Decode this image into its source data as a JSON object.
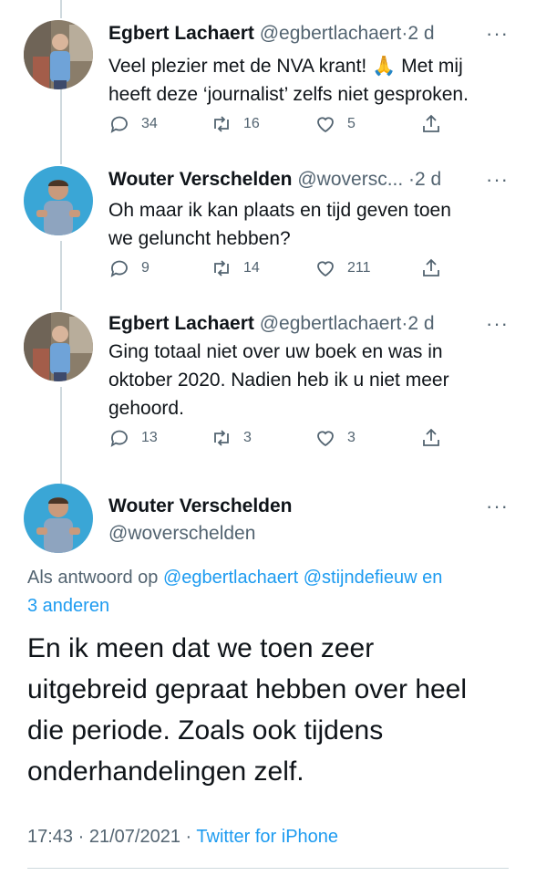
{
  "tweets": [
    {
      "name": "Egbert Lachaert",
      "handle": "@egbertlachaert",
      "sep": "·",
      "time": "2 d",
      "more": "···",
      "lines": [
        "Veel plezier met de NVA krant! 🙏 Met mij",
        "heeft deze ‘journalist’ zelfs niet gesproken."
      ],
      "replies": "34",
      "retweets": "16",
      "likes": "5",
      "avatar_icon": "person-photo-icon"
    },
    {
      "name": "Wouter Verschelden",
      "handle": "@woversc...",
      "sep": "·",
      "time": "2 d",
      "more": "···",
      "lines": [
        "Oh maar ik kan plaats en tijd geven toen",
        "we geluncht hebben?"
      ],
      "replies": "9",
      "retweets": "14",
      "likes": "211",
      "avatar_icon": "person-photo-icon"
    },
    {
      "name": "Egbert Lachaert",
      "handle": "@egbertlachaert",
      "sep": "·",
      "time": "2 d",
      "more": "···",
      "lines": [
        "Ging totaal niet over uw boek en was in",
        "oktober 2020. Nadien heb ik u niet meer",
        "gehoord."
      ],
      "replies": "13",
      "retweets": "3",
      "likes": "3",
      "avatar_icon": "person-photo-icon"
    }
  ],
  "main": {
    "name": "Wouter Verschelden",
    "handle": "@woverschelden",
    "more": "···",
    "reply_prefix": "Als antwoord op",
    "reply_mention1": "@egbertlachaert",
    "reply_mention2": "@stijndefieuw",
    "reply_and": "en",
    "reply_others": "3 anderen",
    "lines": [
      "En ik meen dat we toen zeer",
      "uitgebreid gepraat hebben over heel",
      "die periode. Zoals ook tijdens",
      "onderhandelingen zelf."
    ],
    "time": "17:43",
    "date": "21/07/2021",
    "sep": "·",
    "source": "Twitter for iPhone"
  },
  "colors": {
    "accent": "#1d9bf0",
    "muted": "#536471",
    "line": "#cfd9de"
  },
  "icons": [
    "reply-icon",
    "retweet-icon",
    "like-icon",
    "share-icon",
    "more-icon"
  ]
}
